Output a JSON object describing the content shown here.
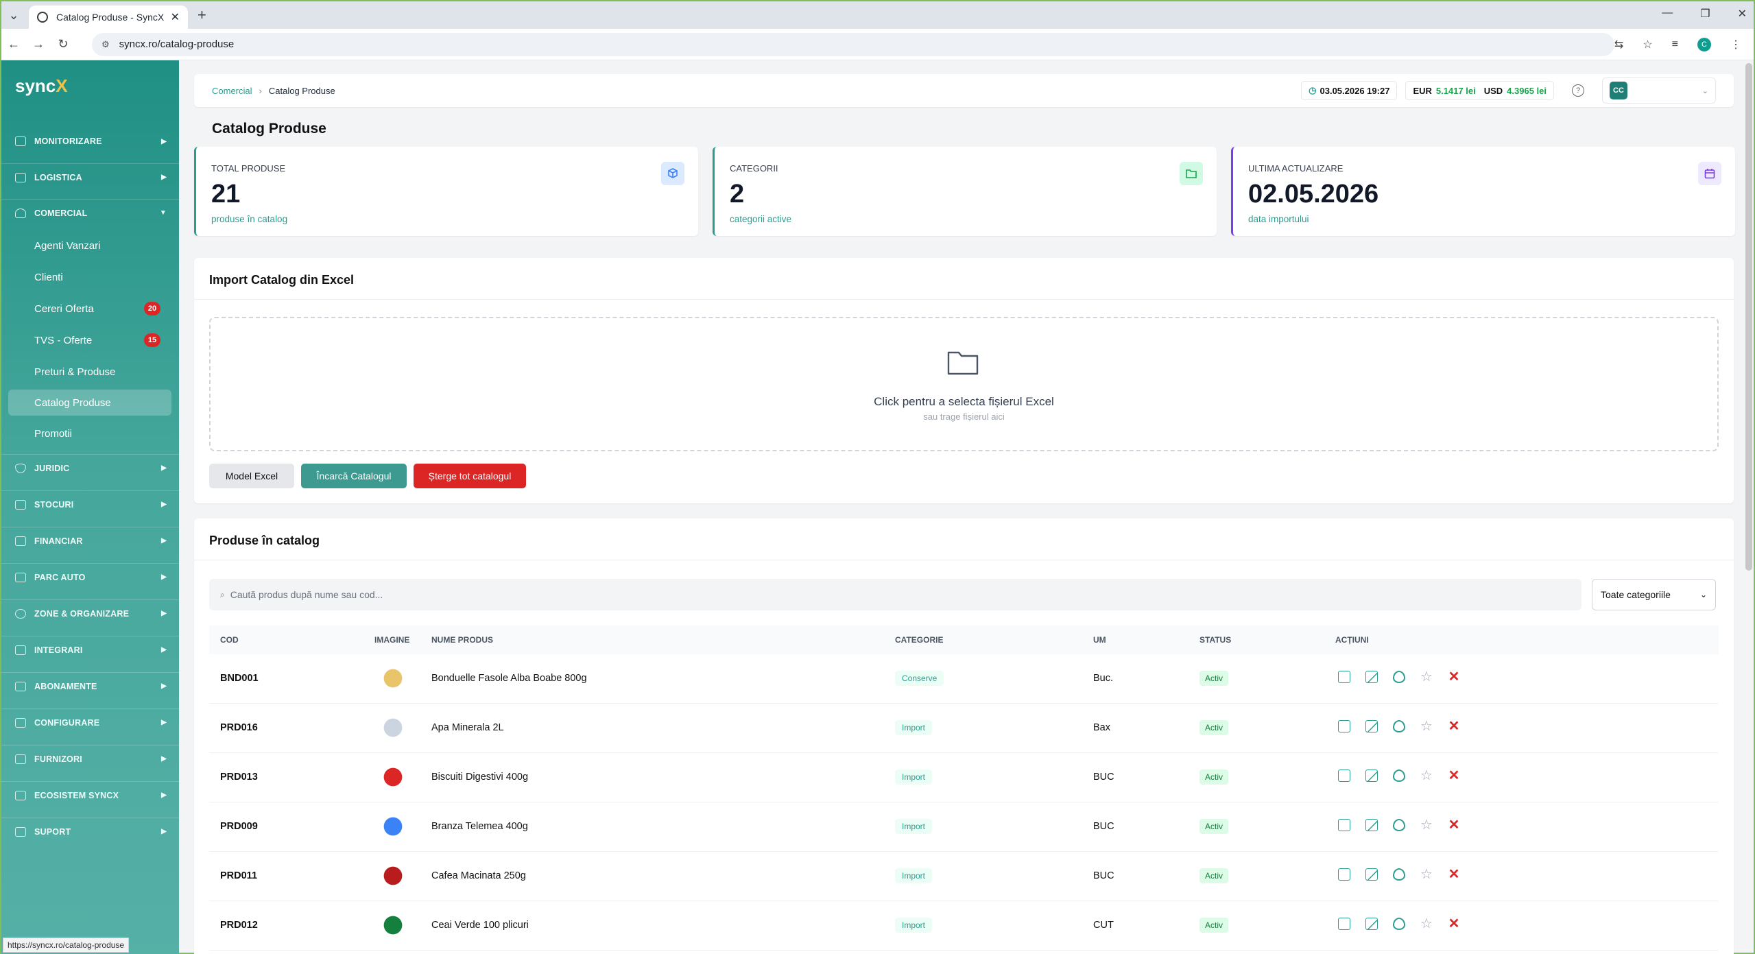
{
  "browser": {
    "tab_title": "Catalog Produse - SyncX",
    "url": "syncx.ro/catalog-produse",
    "status_url": "https://syncx.ro/catalog-produse",
    "profile_initial": "C"
  },
  "sidebar": {
    "logo_main": "sync",
    "logo_accent": "X",
    "sections": [
      {
        "label": "MONITORIZARE"
      },
      {
        "label": "LOGISTICA"
      },
      {
        "label": "COMERCIAL"
      },
      {
        "label": "JURIDIC"
      },
      {
        "label": "STOCURI"
      },
      {
        "label": "FINANCIAR"
      },
      {
        "label": "PARC AUTO"
      },
      {
        "label": "ZONE & ORGANIZARE"
      },
      {
        "label": "INTEGRARI"
      },
      {
        "label": "ABONAMENTE"
      },
      {
        "label": "CONFIGURARE"
      },
      {
        "label": "FURNIZORI"
      },
      {
        "label": "ECOSISTEM SYNCX"
      },
      {
        "label": "SUPORT"
      }
    ],
    "comercial_items": [
      {
        "label": "Agenti Vanzari"
      },
      {
        "label": "Clienti"
      },
      {
        "label": "Cereri Oferta",
        "badge": "20"
      },
      {
        "label": "TVS - Oferte",
        "badge": "15"
      },
      {
        "label": "Preturi & Produse"
      },
      {
        "label": "Catalog Produse"
      },
      {
        "label": "Promotii"
      }
    ]
  },
  "header": {
    "breadcrumb_parent": "Comercial",
    "breadcrumb_current": "Catalog Produse",
    "datetime": "03.05.2026 19:27",
    "eur_label": "EUR",
    "eur_value": "5.1417 lei",
    "usd_label": "USD",
    "usd_value": "4.3965 lei",
    "help": "?",
    "user_initials": "CC"
  },
  "page_title": "Catalog Produse",
  "stats": [
    {
      "label": "TOTAL PRODUSE",
      "value": "21",
      "sub": "produse în catalog",
      "color": "#2a9d8f"
    },
    {
      "label": "CATEGORII",
      "value": "2",
      "sub": "categorii active",
      "color": "#2a9d8f"
    },
    {
      "label": "ULTIMA ACTUALIZARE",
      "value": "02.05.2026",
      "sub": "data importului",
      "color": "#7c3aed"
    }
  ],
  "import": {
    "title": "Import Catalog din Excel",
    "drop_text": "Click pentru a selecta fișierul Excel",
    "drop_hint": "sau trage fișierul aici",
    "btn_model": "Model Excel",
    "btn_upload": "Încarcă Catalogul",
    "btn_delete": "Șterge tot catalogul"
  },
  "products": {
    "title": "Produse în catalog",
    "search_placeholder": "Caută produs după nume sau cod...",
    "category_select": "Toate categoriile",
    "columns": [
      "COD",
      "IMAGINE",
      "NUME PRODUS",
      "CATEGORIE",
      "UM",
      "STATUS",
      "ACȚIUNI"
    ],
    "rows": [
      {
        "cod": "BND001",
        "name": "Bonduelle Fasole Alba Boabe 800g",
        "cat": "Conserve",
        "um": "Buc.",
        "status": "Activ",
        "img": "#e9c46a"
      },
      {
        "cod": "PRD016",
        "name": "Apa Minerala 2L",
        "cat": "Import",
        "um": "Bax",
        "status": "Activ",
        "img": "#cbd5e1"
      },
      {
        "cod": "PRD013",
        "name": "Biscuiti Digestivi 400g",
        "cat": "Import",
        "um": "BUC",
        "status": "Activ",
        "img": "#dc2626"
      },
      {
        "cod": "PRD009",
        "name": "Branza Telemea 400g",
        "cat": "Import",
        "um": "BUC",
        "status": "Activ",
        "img": "#3b82f6"
      },
      {
        "cod": "PRD011",
        "name": "Cafea Macinata 250g",
        "cat": "Import",
        "um": "BUC",
        "status": "Activ",
        "img": "#b91c1c"
      },
      {
        "cod": "PRD012",
        "name": "Ceai Verde 100 plicuri",
        "cat": "Import",
        "um": "CUT",
        "status": "Activ",
        "img": "#15803d"
      }
    ]
  }
}
